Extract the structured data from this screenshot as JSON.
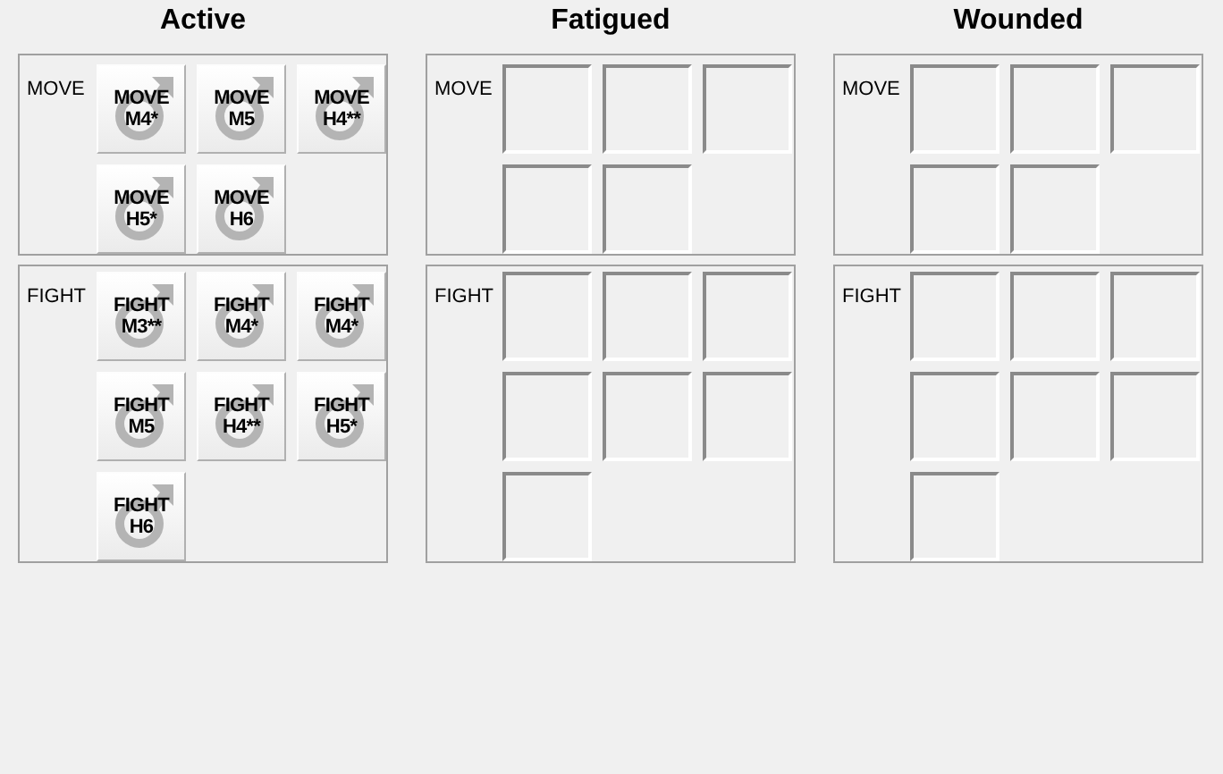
{
  "columns": [
    {
      "title": "Active",
      "sections": [
        {
          "label": "MOVE",
          "slots": [
            {
              "kind": "card",
              "lines": [
                "MOVE",
                "M4*"
              ]
            },
            {
              "kind": "card",
              "lines": [
                "MOVE",
                "M5"
              ]
            },
            {
              "kind": "card",
              "lines": [
                "MOVE",
                "H4**"
              ]
            },
            {
              "kind": "card",
              "lines": [
                "MOVE",
                "H5*"
              ]
            },
            {
              "kind": "card",
              "lines": [
                "MOVE",
                "H6"
              ]
            }
          ]
        },
        {
          "label": "FIGHT",
          "slots": [
            {
              "kind": "card",
              "lines": [
                "FIGHT",
                "M3**"
              ]
            },
            {
              "kind": "card",
              "lines": [
                "FIGHT",
                "M4*"
              ]
            },
            {
              "kind": "card",
              "lines": [
                "FIGHT",
                "M4*"
              ]
            },
            {
              "kind": "card",
              "lines": [
                "FIGHT",
                "M5"
              ]
            },
            {
              "kind": "card",
              "lines": [
                "FIGHT",
                "H4**"
              ]
            },
            {
              "kind": "card",
              "lines": [
                "FIGHT",
                "H5*"
              ]
            },
            {
              "kind": "card",
              "lines": [
                "FIGHT",
                "H6"
              ]
            }
          ]
        }
      ]
    },
    {
      "title": "Fatigued",
      "sections": [
        {
          "label": "MOVE",
          "slots": [
            {
              "kind": "empty"
            },
            {
              "kind": "empty"
            },
            {
              "kind": "empty"
            },
            {
              "kind": "empty"
            },
            {
              "kind": "empty"
            }
          ]
        },
        {
          "label": "FIGHT",
          "slots": [
            {
              "kind": "empty"
            },
            {
              "kind": "empty"
            },
            {
              "kind": "empty"
            },
            {
              "kind": "empty"
            },
            {
              "kind": "empty"
            },
            {
              "kind": "empty"
            },
            {
              "kind": "empty"
            }
          ]
        }
      ]
    },
    {
      "title": "Wounded",
      "sections": [
        {
          "label": "MOVE",
          "slots": [
            {
              "kind": "empty"
            },
            {
              "kind": "empty"
            },
            {
              "kind": "empty"
            },
            {
              "kind": "empty"
            },
            {
              "kind": "empty"
            }
          ]
        },
        {
          "label": "FIGHT",
          "slots": [
            {
              "kind": "empty"
            },
            {
              "kind": "empty"
            },
            {
              "kind": "empty"
            },
            {
              "kind": "empty"
            },
            {
              "kind": "empty"
            },
            {
              "kind": "empty"
            },
            {
              "kind": "empty"
            }
          ]
        }
      ]
    }
  ]
}
